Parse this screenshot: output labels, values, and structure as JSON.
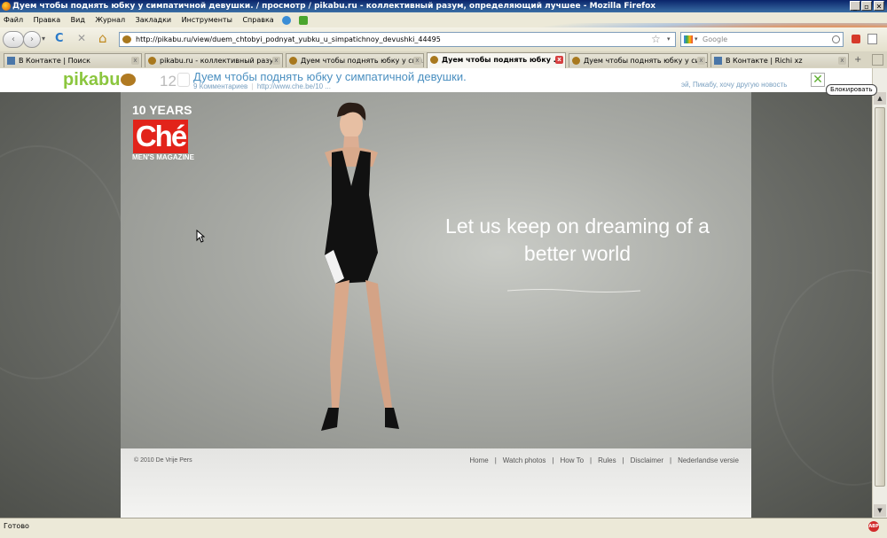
{
  "window": {
    "title": "Дуем чтобы поднять юбку у симпатичной девушки. / просмотр / pikabu.ru - коллективный разум, определяющий лучшее - Mozilla Firefox",
    "minimize": "_",
    "maximize": "▫",
    "close": "✕"
  },
  "menu": [
    "Файл",
    "Правка",
    "Вид",
    "Журнал",
    "Закладки",
    "Инструменты",
    "Справка"
  ],
  "nav": {
    "back": "‹",
    "forward": "›",
    "dropdown": "▾",
    "reload": "C",
    "stop": "✕",
    "home": "⌂",
    "url": "http://pikabu.ru/view/duem_chtobyi_podnyat_yubku_u_simpatichnoy_devushki_44495",
    "bookmark_star": "☆",
    "search_placeholder": "Google"
  },
  "tabs": [
    {
      "label": "В Контакте | Поиск",
      "icon": "vk-icon",
      "active": false
    },
    {
      "label": "pikabu.ru - коллективный разум, ...",
      "icon": "pikabu-icon",
      "active": false
    },
    {
      "label": "Дуем чтобы поднять юбку у сим...",
      "icon": "pikabu-icon",
      "active": false
    },
    {
      "label": "Дуем чтобы поднять юбку ...",
      "icon": "pikabu-icon",
      "active": true
    },
    {
      "label": "Дуем чтобы поднять юбку у сим...",
      "icon": "pikabu-icon",
      "active": false
    },
    {
      "label": "В Контакте | Richi xz",
      "icon": "vk-icon",
      "active": false
    }
  ],
  "tab_close": "x",
  "pikabu": {
    "logo": "pikabu",
    "rating": "12",
    "post_title": "Дуем чтобы поднять юбку у симпатичной девушки.",
    "comments": "9 Комментариев",
    "source": "http://www.che.be/10 ...",
    "next_link": "эй, Пикабу, хочу другую новость",
    "close": "✕",
    "block_button": "Блокировать"
  },
  "page": {
    "brand_years": "10 YEARS",
    "brand_logo": "Ché",
    "brand_sub": "MEN'S MAGAZINE",
    "slogan_line1": "Let us keep on dreaming of a",
    "slogan_line2": "better world",
    "copyright": "© 2010 De Vrije Pers",
    "footer_links": [
      "Home",
      "Watch photos",
      "How To",
      "Rules",
      "Disclaimer",
      "Nederlandse versie"
    ],
    "footer_separator": "|"
  },
  "scroll": {
    "up": "▲",
    "down": "▼"
  },
  "status": {
    "text": "Готово",
    "adblock": "ABP"
  },
  "colors": {
    "pikabu_green": "#8bc63e",
    "link_blue": "#4a8fc0",
    "che_red": "#e2231a",
    "titlebar": "#0a246a"
  }
}
